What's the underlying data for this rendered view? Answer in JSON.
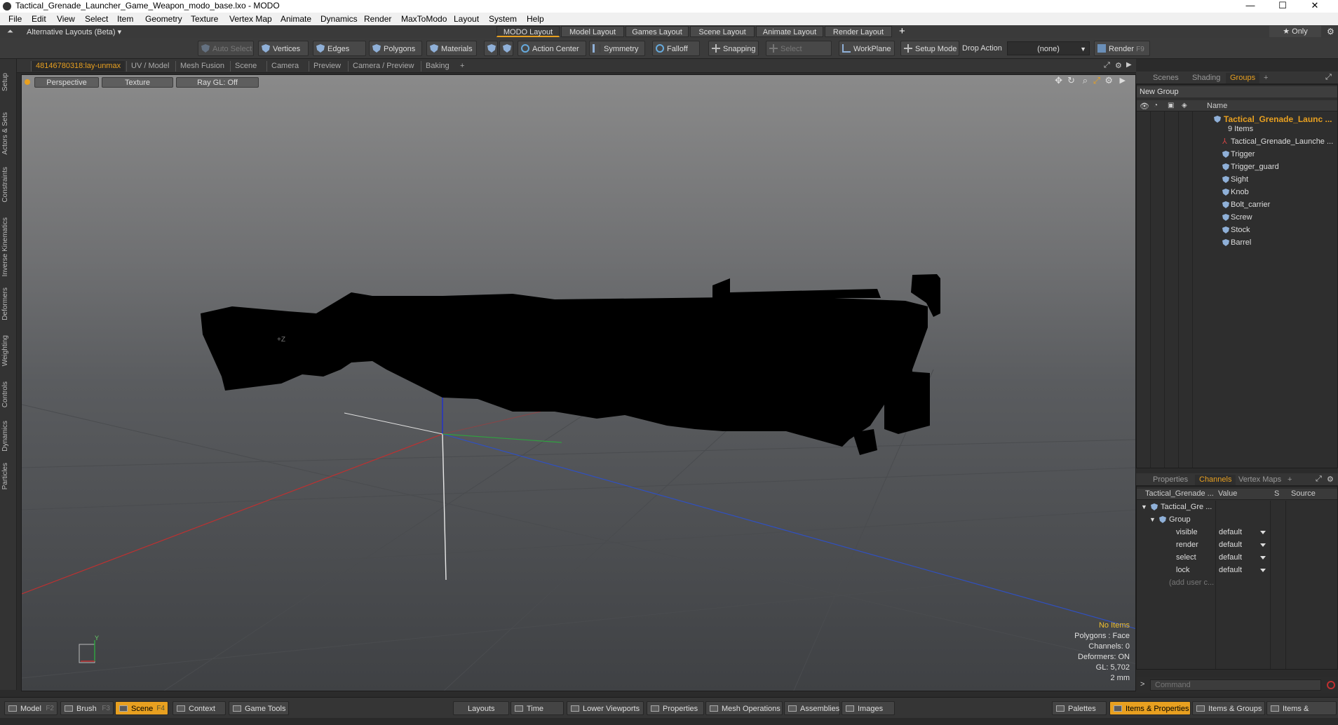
{
  "window": {
    "title": "Tactical_Grenade_Launcher_Game_Weapon_modo_base.lxo - MODO",
    "minimize": "—",
    "maximize": "☐",
    "close": "✕"
  },
  "menu": [
    "File",
    "Edit",
    "View",
    "Select",
    "Item",
    "Geometry",
    "Texture",
    "Vertex Map",
    "Animate",
    "Dynamics",
    "Render",
    "MaxToModo",
    "Layout",
    "System",
    "Help"
  ],
  "layout_row": {
    "alt_layouts": "Alternative Layouts (Beta) ▾",
    "tabs": [
      "MODO Layout",
      "Model Layout",
      "Games Layout",
      "Scene Layout",
      "Animate Layout",
      "Render Layout"
    ],
    "add": "+",
    "only": "★ Only"
  },
  "toolbar": {
    "auto_select": "Auto Select",
    "vertices": "Vertices",
    "edges": "Edges",
    "polygons": "Polygons",
    "materials": "Materials",
    "action_center": "Action Center",
    "symmetry": "Symmetry",
    "falloff": "Falloff",
    "snapping": "Snapping",
    "select_through": "Select Through",
    "workplane": "WorkPlane",
    "setup_mode": "Setup Mode",
    "drop_action": "Drop Action",
    "drop_value": "(none)",
    "render": "Render",
    "render_key": "F9"
  },
  "left_tabs": [
    "Setup",
    "Actors & Sets",
    "Constraints",
    "Inverse Kinematics",
    "Deformers",
    "Weighting",
    "Controls",
    "Dynamics",
    "Particles"
  ],
  "viewport_tabs": [
    "48146780318:lay-unmax",
    "UV / Model",
    "Mesh Fusion",
    "Scene",
    "Camera",
    "Preview",
    "Camera / Preview",
    "Baking",
    "+"
  ],
  "viewport": {
    "view": "Perspective",
    "shading": "Texture",
    "raygl": "Ray GL: Off",
    "info": {
      "items": "No Items",
      "polygons": "Polygons : Face",
      "channels": "Channels: 0",
      "deformers": "Deformers: ON",
      "gl": "GL: 5,702",
      "scale": "2 mm"
    },
    "axis_y": "Y",
    "axis_z": "+Z"
  },
  "right_tabs": [
    "Scenes",
    "Shading",
    "Groups",
    "+"
  ],
  "groups": {
    "new_group": "New Group",
    "name_header": "Name",
    "root": "Tactical_Grenade_Launc ...",
    "root_count": "9 Items",
    "items": [
      "Tactical_Grenade_Launche ...",
      "Trigger",
      "Trigger_guard",
      "Sight",
      "Knob",
      "Bolt_carrier",
      "Screw",
      "Stock",
      "Barrel"
    ]
  },
  "channel_tabs": [
    "Properties",
    "Channels",
    "Vertex Maps",
    "+"
  ],
  "channels": {
    "headers": [
      "Tactical_Grenade ...",
      "Value",
      "S",
      "Source"
    ],
    "root": "Tactical_Gre ...",
    "group": "Group",
    "rows": [
      {
        "name": "visible",
        "value": "default"
      },
      {
        "name": "render",
        "value": "default"
      },
      {
        "name": "select",
        "value": "default"
      },
      {
        "name": "lock",
        "value": "default"
      }
    ],
    "add_user": "(add user c..."
  },
  "command": {
    "placeholder": "Command",
    "prompt": ">"
  },
  "bottom": {
    "left": [
      {
        "label": "Model",
        "key": "F2"
      },
      {
        "label": "Brush",
        "key": "F3"
      },
      {
        "label": "Scene",
        "key": "F4"
      },
      {
        "label": "Context",
        "key": ""
      },
      {
        "label": "Game Tools",
        "key": ""
      }
    ],
    "middle": [
      "Layouts",
      "Time",
      "Lower Viewports",
      "Properties",
      "Mesh Operations",
      "Assemblies",
      "Images"
    ],
    "right": [
      "Palettes",
      "Items & Properties",
      "Items & Groups",
      "Items & Shading"
    ]
  },
  "colors": {
    "accent": "#e8a020",
    "x_axis": "#c03030",
    "y_axis": "#e8e8e8",
    "z_axis": "#3050c0",
    "green_axis": "#30a040"
  }
}
